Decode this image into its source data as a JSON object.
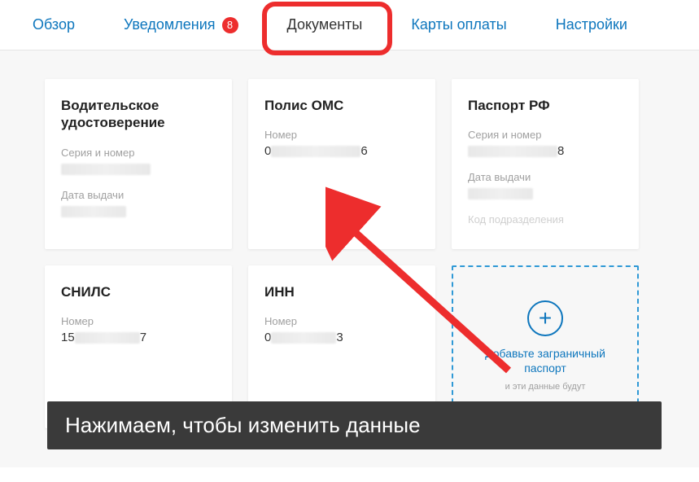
{
  "nav": {
    "overview": "Обзор",
    "notifications": "Уведомления",
    "notifications_badge": "8",
    "documents": "Документы",
    "payment_cards": "Карты оплаты",
    "settings": "Настройки"
  },
  "cards": {
    "driver_license": {
      "title": "Водительское удостоверение",
      "series_label": "Серия и номер",
      "series_value": "",
      "issue_label": "Дата выдачи",
      "issue_value": ""
    },
    "oms": {
      "title": "Полис ОМС",
      "number_label": "Номер",
      "number_start": "0",
      "number_end": "6"
    },
    "passport_rf": {
      "title": "Паспорт РФ",
      "series_label": "Серия и номер",
      "series_end": "8",
      "issue_label": "Дата выдачи",
      "issue_value": "",
      "dept_label": "Код подразделения"
    },
    "snils": {
      "title": "СНИЛС",
      "number_label": "Номер",
      "number_start": "15",
      "number_end": "7"
    },
    "inn": {
      "title": "ИНН",
      "number_label": "Номер",
      "number_start": "0",
      "number_end": "3"
    },
    "add_passport": {
      "title": "Добавьте заграничный паспорт",
      "subtitle": "и эти данные будут"
    }
  },
  "caption": "Нажимаем, чтобы изменить данные"
}
